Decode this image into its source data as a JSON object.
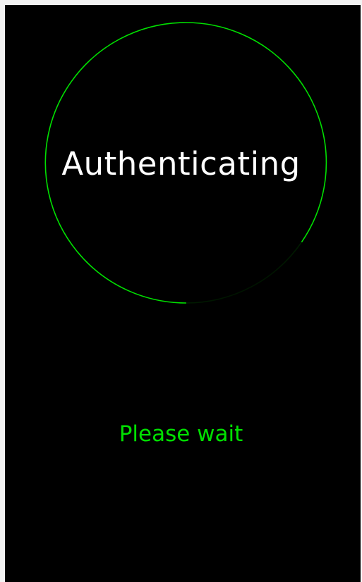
{
  "auth": {
    "title": "Authenticating",
    "status": "Please wait"
  },
  "colors": {
    "background": "#000000",
    "accent": "#00e000",
    "title_text": "#ffffff"
  },
  "icons": {
    "spinner": "progress-ring-icon"
  }
}
